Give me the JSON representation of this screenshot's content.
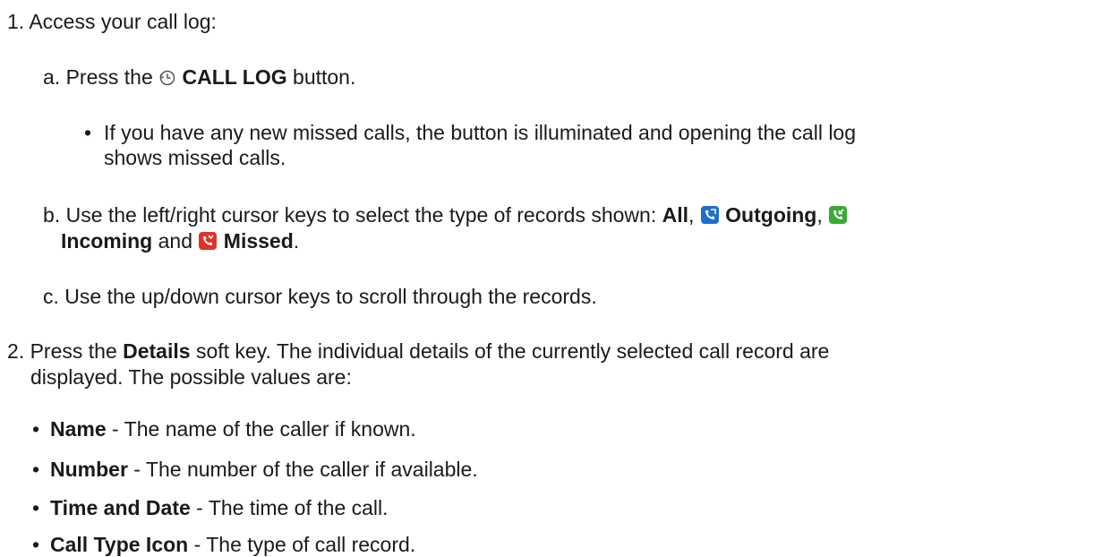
{
  "step1": {
    "num": "1.",
    "text": "Access your call log:",
    "a": {
      "letter": "a.",
      "pre": "Press the",
      "bold": "CALL LOG",
      "post": "button.",
      "bullet": {
        "line1": "If you have any new missed calls, the button is illuminated and opening the call log",
        "line2": "shows missed calls."
      }
    },
    "b": {
      "letter": "b.",
      "pre": "Use the left/right cursor keys to select the type of records shown:",
      "all": "All",
      "outgoing": "Outgoing",
      "incoming": "Incoming",
      "and": "and",
      "missed": "Missed",
      "icons": {
        "outgoing_color": "#1f6fd1",
        "incoming_color": "#3aa935",
        "missed_color": "#e0322b"
      }
    },
    "c": {
      "letter": "c.",
      "text": "Use the up/down cursor keys to scroll through the records."
    }
  },
  "step2": {
    "num": "2.",
    "pre": "Press the",
    "bold": "Details",
    "post": "soft key. The individual details of the currently selected call record are",
    "line2": "displayed. The possible values are:",
    "items": [
      {
        "term": "Name",
        "desc": " - The name of the caller if known."
      },
      {
        "term": "Number",
        "desc": " - The number of the caller if available."
      },
      {
        "term": "Time and Date",
        "desc": " - The time of the call."
      },
      {
        "term": "Call Type Icon",
        "desc": " - The type of call record."
      }
    ]
  }
}
